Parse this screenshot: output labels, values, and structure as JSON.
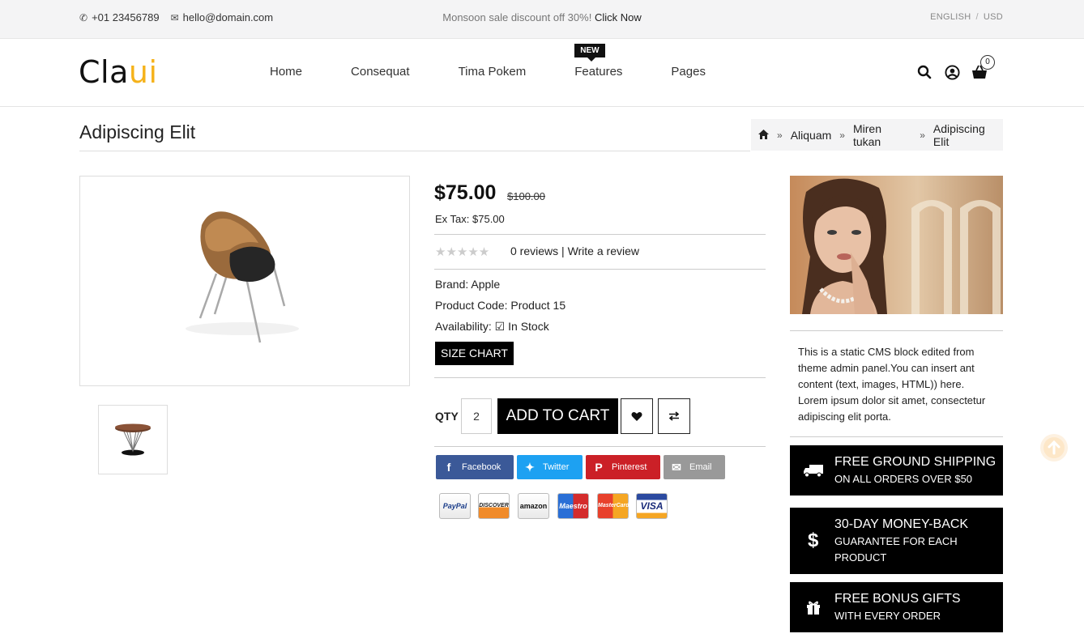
{
  "topbar": {
    "phone": "+01 23456789",
    "email": "hello@domain.com",
    "promo_text": "Monsoon sale discount off 30%!",
    "promo_link": "Click Now",
    "language": "ENGLISH",
    "currency": "USD"
  },
  "header": {
    "logo_part1": "Cla",
    "logo_part2": "ui",
    "nav": [
      "Home",
      "Consequat",
      "Tima Pokem",
      "Features",
      "Pages"
    ],
    "features_badge": "NEW",
    "cart_count": "0"
  },
  "page": {
    "title": "Adipiscing Elit",
    "breadcrumb": [
      "Aliquam",
      "Miren tukan",
      "Adipiscing Elit"
    ]
  },
  "product": {
    "price": "$75.00",
    "old_price": "$100.00",
    "ex_tax": "Ex Tax: $75.00",
    "reviews_link": "0 reviews",
    "review_sep": " | ",
    "write_review": "Write a review",
    "rating": 0,
    "brand_label": "Brand:",
    "brand": "Apple",
    "code_label": "Product Code:",
    "code": "Product 15",
    "availability_label": "Availability:",
    "availability": "In Stock",
    "size_chart": "SIZE CHART",
    "qty_label": "QTY",
    "qty_value": "2",
    "add_to_cart": "ADD TO CART"
  },
  "share": {
    "facebook": "Facebook",
    "twitter": "Twitter",
    "pinterest": "Pinterest",
    "email": "Email"
  },
  "payments": [
    "PayPal",
    "DISCOVER",
    "amazon",
    "Maestro",
    "MasterCard",
    "VISA"
  ],
  "sidebar": {
    "cms_text": "This is a static CMS block edited from theme admin panel.You can insert ant content (text, images, HTML)) here. Lorem ipsum dolor sit amet, consectetur adipiscing elit porta.",
    "features": [
      {
        "title": "FREE GROUND SHIPPING",
        "sub": "ON ALL ORDERS OVER $50"
      },
      {
        "title": "30-DAY MONEY-BACK",
        "sub": "GUARANTEE FOR EACH PRODUCT"
      },
      {
        "title": "FREE BONUS GIFTS",
        "sub": "WITH EVERY ORDER"
      }
    ]
  },
  "colors": {
    "accent": "#f5b21a",
    "facebook": "#3b5998",
    "twitter": "#1da1f2",
    "pinterest": "#cb2027",
    "email": "#999999"
  }
}
